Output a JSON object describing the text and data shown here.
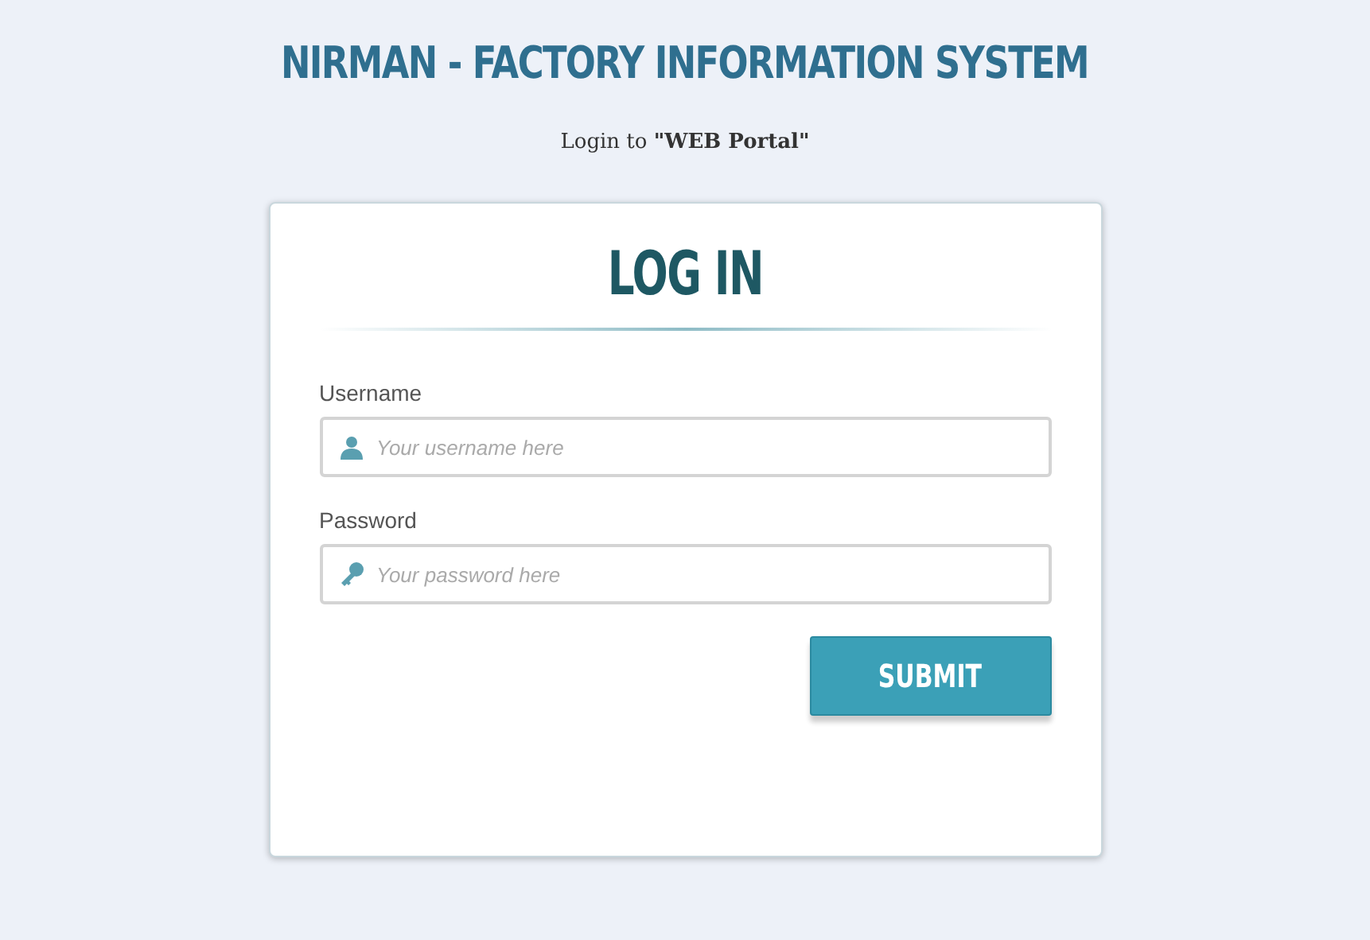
{
  "header": {
    "title": "NIRMAN - FACTORY INFORMATION SYSTEM",
    "subtitle": "Login to **\"WEB Portal\"**"
  },
  "login_form": {
    "heading": "LOG IN",
    "fields": [
      {
        "label": "Username",
        "placeholder": "Your username here",
        "kind": "user"
      },
      {
        "label": "Password",
        "placeholder": "Your password here",
        "kind": "password"
      }
    ],
    "submit": "SUBMIT"
  }
}
